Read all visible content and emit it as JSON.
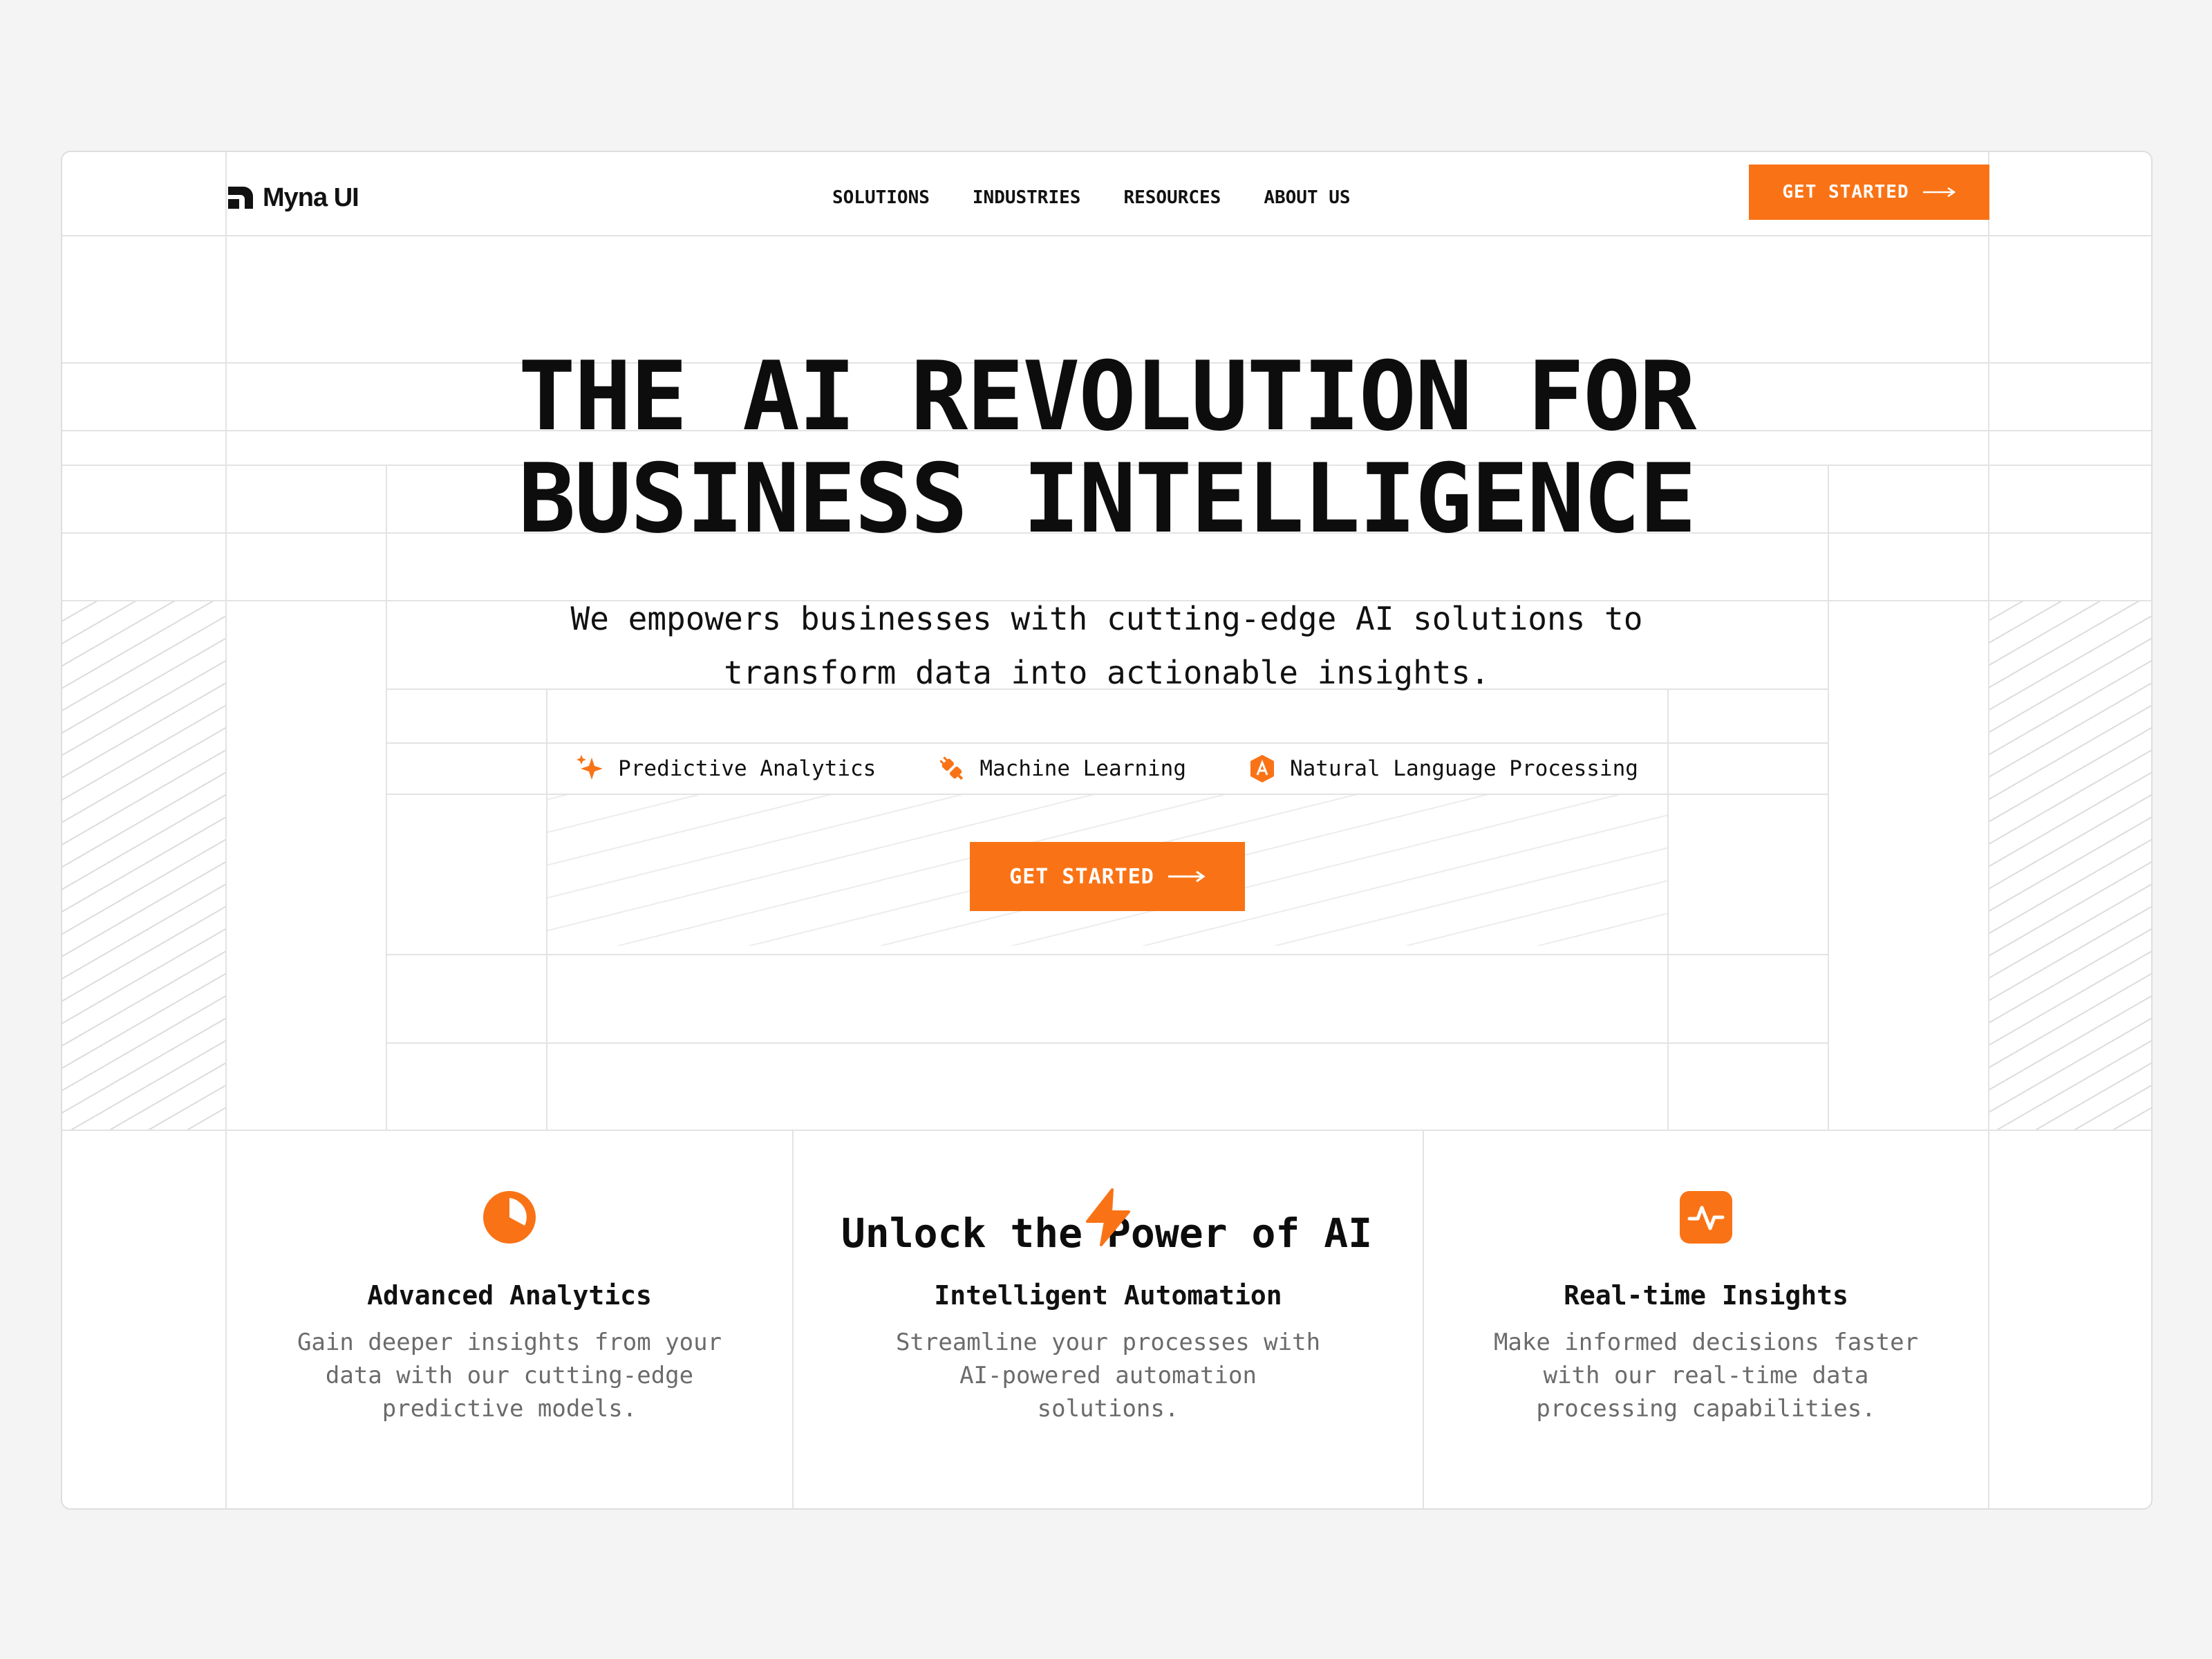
{
  "brand": {
    "name": "Myna UI",
    "accent": "#f97316"
  },
  "nav": {
    "items": [
      "SOLUTIONS",
      "INDUSTRIES",
      "RESOURCES",
      "ABOUT US"
    ],
    "cta": "GET STARTED"
  },
  "hero": {
    "title_lines": [
      "THE AI REVOLUTION FOR",
      "BUSINESS INTELLIGENCE"
    ],
    "subtitle_lines": [
      "We empowers businesses with cutting-edge AI solutions to",
      "transform data into actionable insights."
    ],
    "features": [
      {
        "label": "Predictive Analytics",
        "icon": "sparkles-icon"
      },
      {
        "label": "Machine Learning",
        "icon": "plug-icon"
      },
      {
        "label": "Natural Language Processing",
        "icon": "badge-a-icon"
      }
    ],
    "cta": "GET STARTED"
  },
  "section": {
    "title": "Unlock the Power of AI",
    "cards": [
      {
        "title": "Advanced Analytics",
        "icon": "pie-chart-icon",
        "desc_lines": [
          "Gain deeper insights from your",
          "data with our cutting-edge",
          "predictive models."
        ]
      },
      {
        "title": "Intelligent Automation",
        "icon": "lightning-icon",
        "desc_lines": [
          "Streamline your processes with",
          "AI-powered automation",
          "solutions."
        ]
      },
      {
        "title": "Real-time Insights",
        "icon": "activity-icon",
        "desc_lines": [
          "Make informed decisions faster",
          "with our real-time data",
          "processing capabilities."
        ]
      }
    ]
  }
}
